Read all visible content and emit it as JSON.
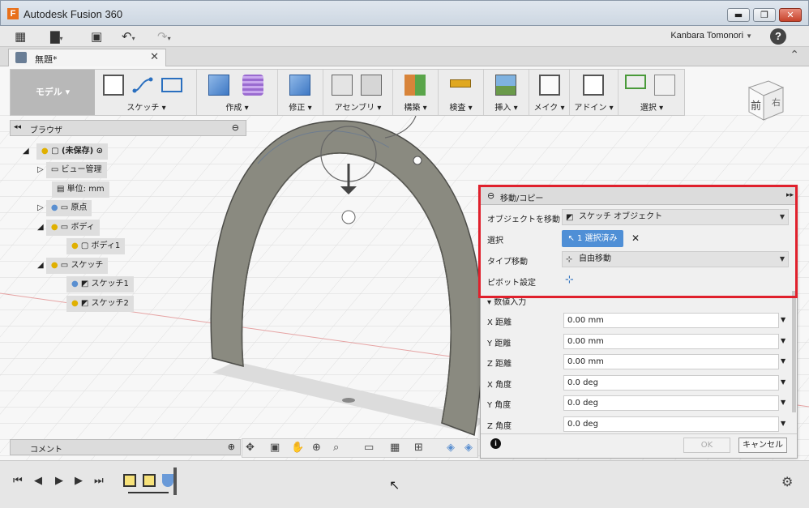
{
  "window": {
    "title": "Autodesk Fusion 360",
    "minimize": "▬",
    "maximize": "❐",
    "close": "✕"
  },
  "quick_access": {
    "user": "Kanbara Tomonori",
    "help": "?"
  },
  "document_tab": {
    "title": "無題*"
  },
  "toolbar": {
    "workspace": "モデル ▾",
    "groups": [
      {
        "label": "スケッチ ▾"
      },
      {
        "label": "作成 ▾"
      },
      {
        "label": "修正 ▾"
      },
      {
        "label": "アセンブリ ▾"
      },
      {
        "label": "構築 ▾"
      },
      {
        "label": "検査 ▾"
      },
      {
        "label": "挿入 ▾"
      },
      {
        "label": "メイク ▾"
      },
      {
        "label": "アドイン ▾"
      },
      {
        "label": "選択 ▾"
      }
    ]
  },
  "view_cube": {
    "face": "前",
    "side": "右"
  },
  "browser": {
    "title": "ブラウザ",
    "root": "(未保存)",
    "items": [
      "ビュー管理",
      "単位: mm",
      "原点",
      "ボディ",
      "ボディ1",
      "スケッチ",
      "スケッチ1",
      "スケッチ2"
    ]
  },
  "comment": {
    "label": "コメント"
  },
  "panel": {
    "title": "移動/コピー",
    "rows": {
      "move_object_label": "オブジェクトを移動",
      "move_object_value": "スケッチ オブジェクト",
      "select_label": "選択",
      "select_value": "1 選択済み",
      "move_type_label": "タイプ移動",
      "move_type_value": "自由移動",
      "pivot_label": "ピボット設定",
      "numeric_header": "数値入力"
    },
    "fields": [
      {
        "label": "X 距離",
        "value": "0.00 mm"
      },
      {
        "label": "Y 距離",
        "value": "0.00 mm"
      },
      {
        "label": "Z 距離",
        "value": "0.00 mm"
      },
      {
        "label": "X 角度",
        "value": "0.0 deg"
      },
      {
        "label": "Y 角度",
        "value": "0.0 deg"
      },
      {
        "label": "Z 角度",
        "value": "0.0 deg"
      }
    ],
    "ok": "OK",
    "cancel": "キャンセル"
  },
  "colors": {
    "highlight": "#e0202c",
    "accent": "#4f8fd6",
    "body": "#7a7a72"
  }
}
